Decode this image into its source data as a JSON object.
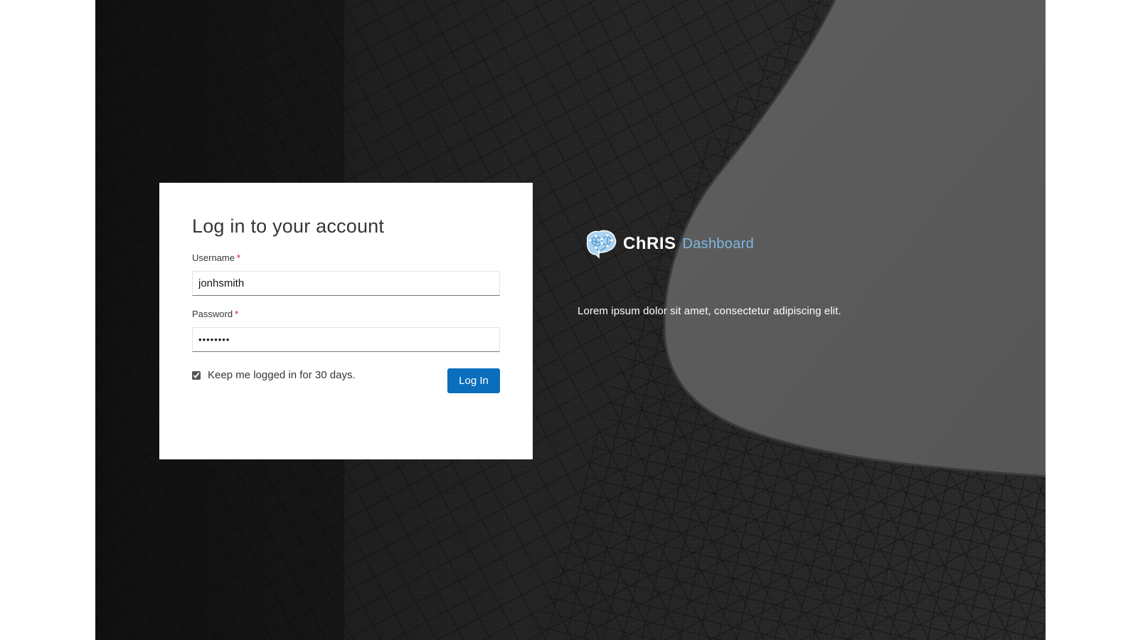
{
  "login": {
    "title": "Log in to your account",
    "username_label": "Username",
    "username_value": "jonhsmith",
    "password_label": "Password",
    "password_value": "••••••••",
    "required_marker": "*",
    "remember_label": "Keep me logged in for 30 days.",
    "remember_checked": true,
    "submit_label": "Log In"
  },
  "brand": {
    "name": "ChRIS",
    "sub": "Dashboard",
    "tagline": "Lorem ipsum dolor sit amet, consectetur adipiscing elit.",
    "logo_icon": "brain-network-icon"
  },
  "colors": {
    "accent": "#0b6ebd",
    "brand_sub": "#7fb6e0",
    "required": "#c9190b",
    "background_dark": "#1b1b1b",
    "background_light": "#5c5c5c"
  }
}
